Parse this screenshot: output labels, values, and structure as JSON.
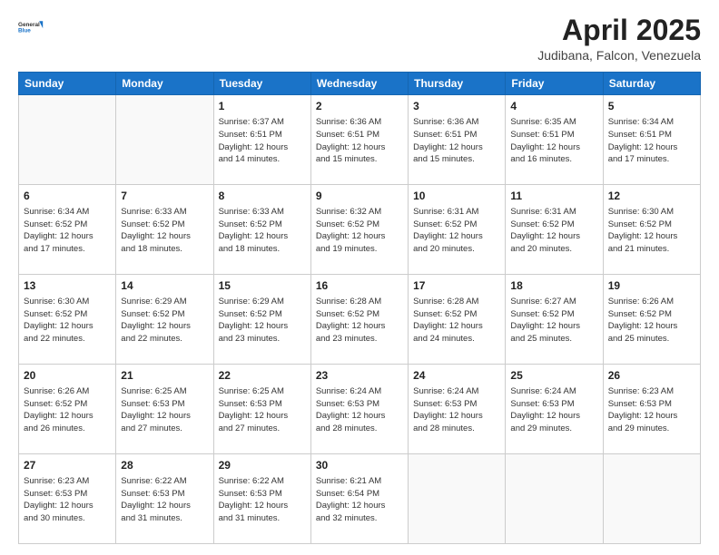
{
  "header": {
    "logo": {
      "line1": "General",
      "line2": "Blue"
    },
    "title": "April 2025",
    "subtitle": "Judibana, Falcon, Venezuela"
  },
  "weekdays": [
    "Sunday",
    "Monday",
    "Tuesday",
    "Wednesday",
    "Thursday",
    "Friday",
    "Saturday"
  ],
  "weeks": [
    [
      {
        "num": "",
        "info": ""
      },
      {
        "num": "",
        "info": ""
      },
      {
        "num": "1",
        "info": "Sunrise: 6:37 AM\nSunset: 6:51 PM\nDaylight: 12 hours\nand 14 minutes."
      },
      {
        "num": "2",
        "info": "Sunrise: 6:36 AM\nSunset: 6:51 PM\nDaylight: 12 hours\nand 15 minutes."
      },
      {
        "num": "3",
        "info": "Sunrise: 6:36 AM\nSunset: 6:51 PM\nDaylight: 12 hours\nand 15 minutes."
      },
      {
        "num": "4",
        "info": "Sunrise: 6:35 AM\nSunset: 6:51 PM\nDaylight: 12 hours\nand 16 minutes."
      },
      {
        "num": "5",
        "info": "Sunrise: 6:34 AM\nSunset: 6:51 PM\nDaylight: 12 hours\nand 17 minutes."
      }
    ],
    [
      {
        "num": "6",
        "info": "Sunrise: 6:34 AM\nSunset: 6:52 PM\nDaylight: 12 hours\nand 17 minutes."
      },
      {
        "num": "7",
        "info": "Sunrise: 6:33 AM\nSunset: 6:52 PM\nDaylight: 12 hours\nand 18 minutes."
      },
      {
        "num": "8",
        "info": "Sunrise: 6:33 AM\nSunset: 6:52 PM\nDaylight: 12 hours\nand 18 minutes."
      },
      {
        "num": "9",
        "info": "Sunrise: 6:32 AM\nSunset: 6:52 PM\nDaylight: 12 hours\nand 19 minutes."
      },
      {
        "num": "10",
        "info": "Sunrise: 6:31 AM\nSunset: 6:52 PM\nDaylight: 12 hours\nand 20 minutes."
      },
      {
        "num": "11",
        "info": "Sunrise: 6:31 AM\nSunset: 6:52 PM\nDaylight: 12 hours\nand 20 minutes."
      },
      {
        "num": "12",
        "info": "Sunrise: 6:30 AM\nSunset: 6:52 PM\nDaylight: 12 hours\nand 21 minutes."
      }
    ],
    [
      {
        "num": "13",
        "info": "Sunrise: 6:30 AM\nSunset: 6:52 PM\nDaylight: 12 hours\nand 22 minutes."
      },
      {
        "num": "14",
        "info": "Sunrise: 6:29 AM\nSunset: 6:52 PM\nDaylight: 12 hours\nand 22 minutes."
      },
      {
        "num": "15",
        "info": "Sunrise: 6:29 AM\nSunset: 6:52 PM\nDaylight: 12 hours\nand 23 minutes."
      },
      {
        "num": "16",
        "info": "Sunrise: 6:28 AM\nSunset: 6:52 PM\nDaylight: 12 hours\nand 23 minutes."
      },
      {
        "num": "17",
        "info": "Sunrise: 6:28 AM\nSunset: 6:52 PM\nDaylight: 12 hours\nand 24 minutes."
      },
      {
        "num": "18",
        "info": "Sunrise: 6:27 AM\nSunset: 6:52 PM\nDaylight: 12 hours\nand 25 minutes."
      },
      {
        "num": "19",
        "info": "Sunrise: 6:26 AM\nSunset: 6:52 PM\nDaylight: 12 hours\nand 25 minutes."
      }
    ],
    [
      {
        "num": "20",
        "info": "Sunrise: 6:26 AM\nSunset: 6:52 PM\nDaylight: 12 hours\nand 26 minutes."
      },
      {
        "num": "21",
        "info": "Sunrise: 6:25 AM\nSunset: 6:53 PM\nDaylight: 12 hours\nand 27 minutes."
      },
      {
        "num": "22",
        "info": "Sunrise: 6:25 AM\nSunset: 6:53 PM\nDaylight: 12 hours\nand 27 minutes."
      },
      {
        "num": "23",
        "info": "Sunrise: 6:24 AM\nSunset: 6:53 PM\nDaylight: 12 hours\nand 28 minutes."
      },
      {
        "num": "24",
        "info": "Sunrise: 6:24 AM\nSunset: 6:53 PM\nDaylight: 12 hours\nand 28 minutes."
      },
      {
        "num": "25",
        "info": "Sunrise: 6:24 AM\nSunset: 6:53 PM\nDaylight: 12 hours\nand 29 minutes."
      },
      {
        "num": "26",
        "info": "Sunrise: 6:23 AM\nSunset: 6:53 PM\nDaylight: 12 hours\nand 29 minutes."
      }
    ],
    [
      {
        "num": "27",
        "info": "Sunrise: 6:23 AM\nSunset: 6:53 PM\nDaylight: 12 hours\nand 30 minutes."
      },
      {
        "num": "28",
        "info": "Sunrise: 6:22 AM\nSunset: 6:53 PM\nDaylight: 12 hours\nand 31 minutes."
      },
      {
        "num": "29",
        "info": "Sunrise: 6:22 AM\nSunset: 6:53 PM\nDaylight: 12 hours\nand 31 minutes."
      },
      {
        "num": "30",
        "info": "Sunrise: 6:21 AM\nSunset: 6:54 PM\nDaylight: 12 hours\nand 32 minutes."
      },
      {
        "num": "",
        "info": ""
      },
      {
        "num": "",
        "info": ""
      },
      {
        "num": "",
        "info": ""
      }
    ]
  ]
}
